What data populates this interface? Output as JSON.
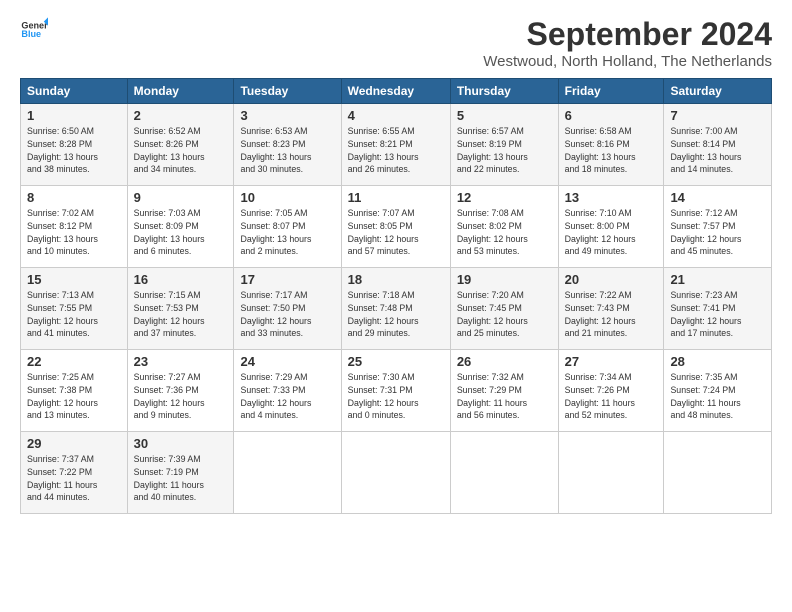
{
  "header": {
    "logo": {
      "line1": "General",
      "line2": "Blue"
    },
    "title": "September 2024",
    "location": "Westwoud, North Holland, The Netherlands"
  },
  "calendar": {
    "days_of_week": [
      "Sunday",
      "Monday",
      "Tuesday",
      "Wednesday",
      "Thursday",
      "Friday",
      "Saturday"
    ],
    "weeks": [
      [
        null,
        {
          "day": 2,
          "info": "Sunrise: 6:52 AM\nSunset: 8:26 PM\nDaylight: 13 hours\nand 34 minutes."
        },
        {
          "day": 3,
          "info": "Sunrise: 6:53 AM\nSunset: 8:23 PM\nDaylight: 13 hours\nand 30 minutes."
        },
        {
          "day": 4,
          "info": "Sunrise: 6:55 AM\nSunset: 8:21 PM\nDaylight: 13 hours\nand 26 minutes."
        },
        {
          "day": 5,
          "info": "Sunrise: 6:57 AM\nSunset: 8:19 PM\nDaylight: 13 hours\nand 22 minutes."
        },
        {
          "day": 6,
          "info": "Sunrise: 6:58 AM\nSunset: 8:16 PM\nDaylight: 13 hours\nand 18 minutes."
        },
        {
          "day": 7,
          "info": "Sunrise: 7:00 AM\nSunset: 8:14 PM\nDaylight: 13 hours\nand 14 minutes."
        }
      ],
      [
        {
          "day": 8,
          "info": "Sunrise: 7:02 AM\nSunset: 8:12 PM\nDaylight: 13 hours\nand 10 minutes."
        },
        {
          "day": 9,
          "info": "Sunrise: 7:03 AM\nSunset: 8:09 PM\nDaylight: 13 hours\nand 6 minutes."
        },
        {
          "day": 10,
          "info": "Sunrise: 7:05 AM\nSunset: 8:07 PM\nDaylight: 13 hours\nand 2 minutes."
        },
        {
          "day": 11,
          "info": "Sunrise: 7:07 AM\nSunset: 8:05 PM\nDaylight: 12 hours\nand 57 minutes."
        },
        {
          "day": 12,
          "info": "Sunrise: 7:08 AM\nSunset: 8:02 PM\nDaylight: 12 hours\nand 53 minutes."
        },
        {
          "day": 13,
          "info": "Sunrise: 7:10 AM\nSunset: 8:00 PM\nDaylight: 12 hours\nand 49 minutes."
        },
        {
          "day": 14,
          "info": "Sunrise: 7:12 AM\nSunset: 7:57 PM\nDaylight: 12 hours\nand 45 minutes."
        }
      ],
      [
        {
          "day": 15,
          "info": "Sunrise: 7:13 AM\nSunset: 7:55 PM\nDaylight: 12 hours\nand 41 minutes."
        },
        {
          "day": 16,
          "info": "Sunrise: 7:15 AM\nSunset: 7:53 PM\nDaylight: 12 hours\nand 37 minutes."
        },
        {
          "day": 17,
          "info": "Sunrise: 7:17 AM\nSunset: 7:50 PM\nDaylight: 12 hours\nand 33 minutes."
        },
        {
          "day": 18,
          "info": "Sunrise: 7:18 AM\nSunset: 7:48 PM\nDaylight: 12 hours\nand 29 minutes."
        },
        {
          "day": 19,
          "info": "Sunrise: 7:20 AM\nSunset: 7:45 PM\nDaylight: 12 hours\nand 25 minutes."
        },
        {
          "day": 20,
          "info": "Sunrise: 7:22 AM\nSunset: 7:43 PM\nDaylight: 12 hours\nand 21 minutes."
        },
        {
          "day": 21,
          "info": "Sunrise: 7:23 AM\nSunset: 7:41 PM\nDaylight: 12 hours\nand 17 minutes."
        }
      ],
      [
        {
          "day": 22,
          "info": "Sunrise: 7:25 AM\nSunset: 7:38 PM\nDaylight: 12 hours\nand 13 minutes."
        },
        {
          "day": 23,
          "info": "Sunrise: 7:27 AM\nSunset: 7:36 PM\nDaylight: 12 hours\nand 9 minutes."
        },
        {
          "day": 24,
          "info": "Sunrise: 7:29 AM\nSunset: 7:33 PM\nDaylight: 12 hours\nand 4 minutes."
        },
        {
          "day": 25,
          "info": "Sunrise: 7:30 AM\nSunset: 7:31 PM\nDaylight: 12 hours\nand 0 minutes."
        },
        {
          "day": 26,
          "info": "Sunrise: 7:32 AM\nSunset: 7:29 PM\nDaylight: 11 hours\nand 56 minutes."
        },
        {
          "day": 27,
          "info": "Sunrise: 7:34 AM\nSunset: 7:26 PM\nDaylight: 11 hours\nand 52 minutes."
        },
        {
          "day": 28,
          "info": "Sunrise: 7:35 AM\nSunset: 7:24 PM\nDaylight: 11 hours\nand 48 minutes."
        }
      ],
      [
        {
          "day": 29,
          "info": "Sunrise: 7:37 AM\nSunset: 7:22 PM\nDaylight: 11 hours\nand 44 minutes."
        },
        {
          "day": 30,
          "info": "Sunrise: 7:39 AM\nSunset: 7:19 PM\nDaylight: 11 hours\nand 40 minutes."
        },
        null,
        null,
        null,
        null,
        null
      ]
    ],
    "week0_sunday": {
      "day": 1,
      "info": "Sunrise: 6:50 AM\nSunset: 8:28 PM\nDaylight: 13 hours\nand 38 minutes."
    }
  }
}
